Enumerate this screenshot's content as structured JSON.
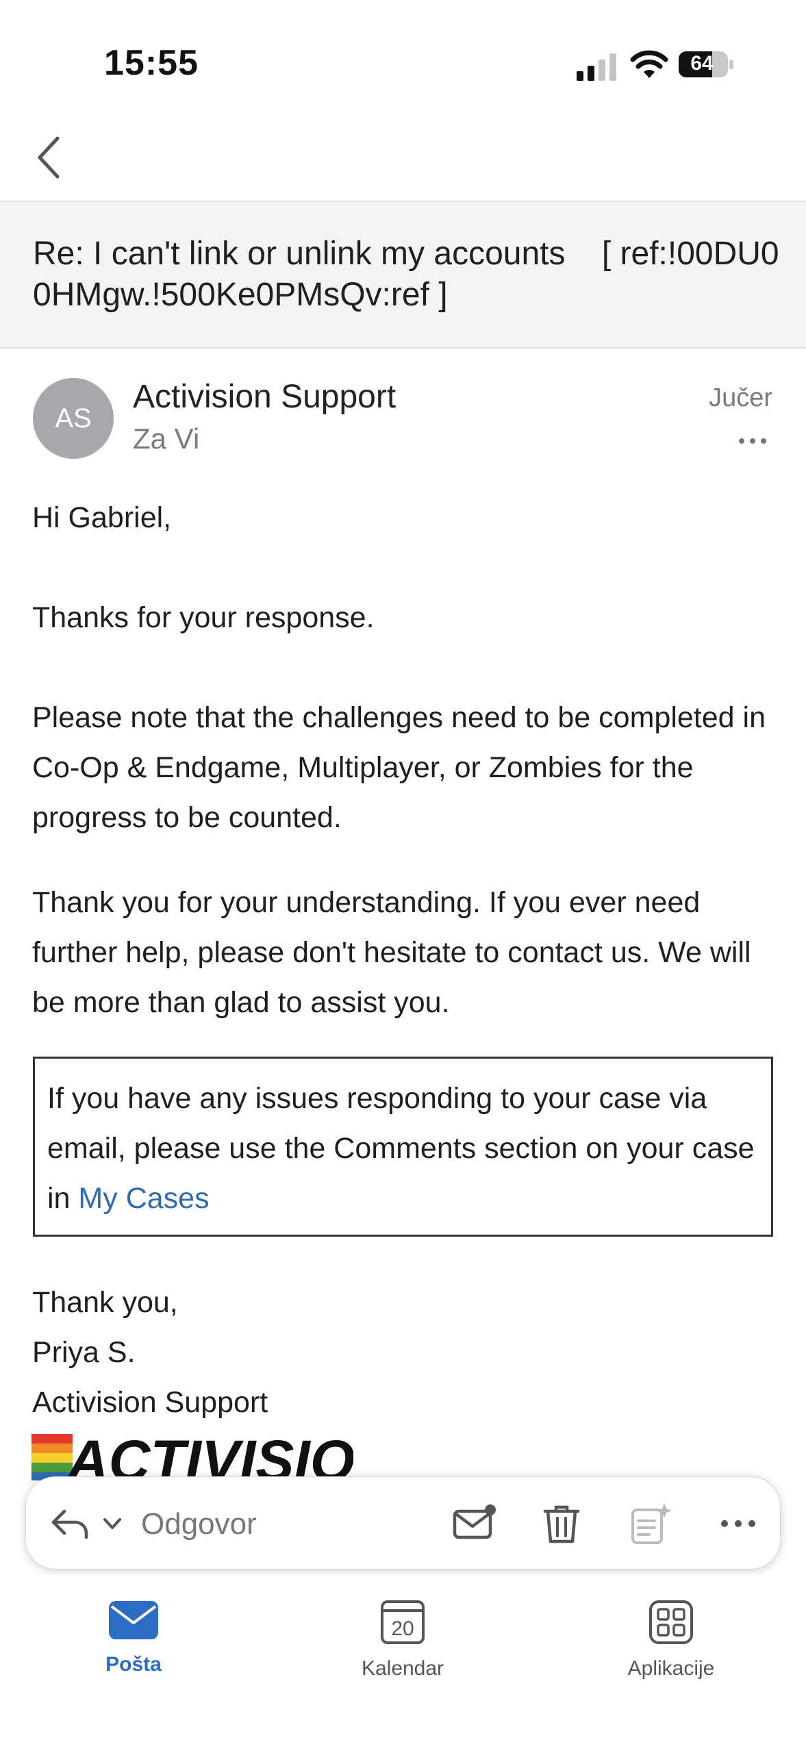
{
  "status_bar": {
    "time": "15:55",
    "battery": "64"
  },
  "email": {
    "subject": "Re: I can't link or unlink my accounts    [ ref:!00DU00HMgw.!500Ke0PMsQv:ref ]",
    "sender": {
      "initials": "AS",
      "name": "Activision Support",
      "recipient": "Za Vi",
      "date": "Jučer"
    },
    "body": {
      "greeting": "Hi Gabriel,",
      "thanks": "Thanks for your response.",
      "para1": "Please note that the challenges need to be completed in Co-Op & Endgame, Multiplayer, or Zombies for the progress to be counted.",
      "para2": "Thank you for your understanding. If you ever need further help, please don't hesitate to contact us. We will be more than glad to assist you.",
      "notice_text": "If you have any issues responding to your case via email, please use the Comments section on your case in ",
      "notice_link": "My Cases",
      "signoff": "Thank you,",
      "agent": "Priya S.",
      "team": "Activision Support",
      "logo_text": "ACTIVISION"
    }
  },
  "toolbar": {
    "reply_label": "Odgovor"
  },
  "tabs": [
    {
      "label": "Pošta",
      "active": true
    },
    {
      "label": "Kalendar",
      "day": "20"
    },
    {
      "label": "Aplikacije"
    }
  ],
  "colors": {
    "accent": "#2b6cc4",
    "link": "#2f6bb4",
    "avatar": "#a8a7ab"
  }
}
